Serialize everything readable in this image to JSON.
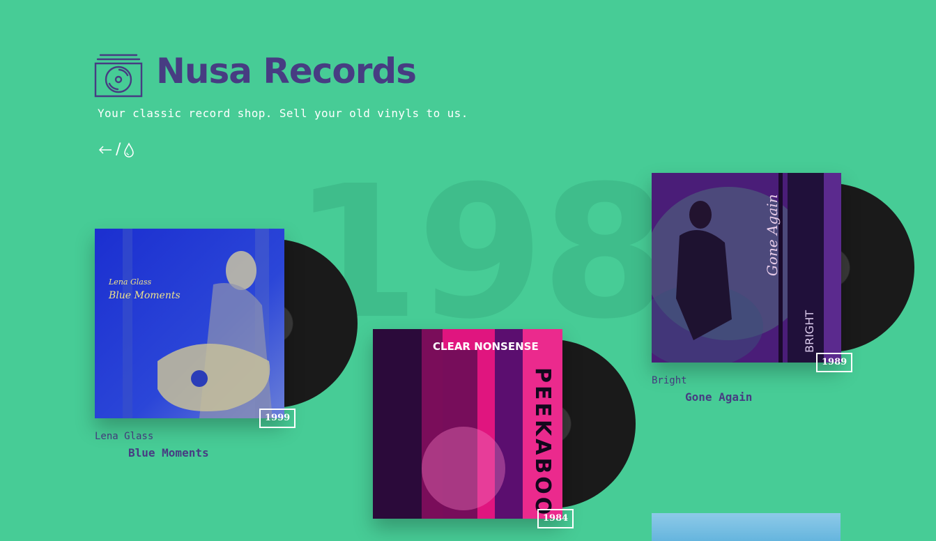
{
  "brand": {
    "name": "Nusa Records",
    "tagline": "Your classic record shop. Sell your old vinyls to us.",
    "logo_icon": "vinyl-crate-icon",
    "color": "#473c82"
  },
  "background_year": "1985",
  "nav": {
    "back_icon": "arrow-left-icon",
    "separator": "/",
    "theme_icon": "droplet-icon"
  },
  "albums": [
    {
      "artist": "Lena Glass",
      "title": "Blue Moments",
      "year": "1999",
      "cover_text": [
        "Lena Glass",
        "Blue Moments"
      ]
    },
    {
      "artist": "",
      "title": "",
      "year": "1984",
      "cover_text": [
        "CLEAR NONSENSE",
        "PEEKABOO"
      ]
    },
    {
      "artist": "Bright",
      "title": "Gone Again",
      "year": "1989",
      "cover_text": [
        "Gone Again",
        "BRIGHT"
      ]
    }
  ],
  "colors": {
    "background": "#47cc96",
    "accent": "#473c82",
    "year_watermark": "#3fbd8b"
  }
}
